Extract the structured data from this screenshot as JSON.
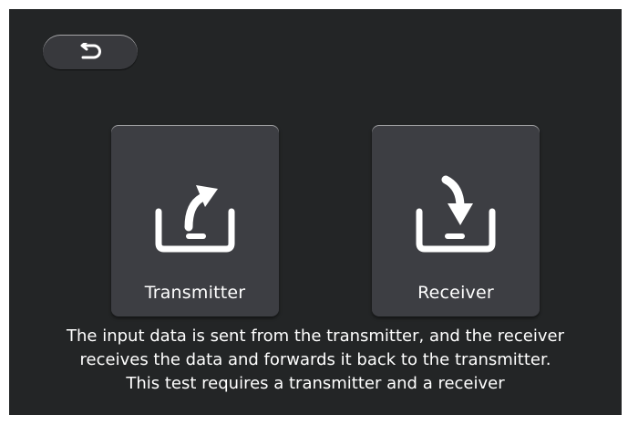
{
  "back_button": {
    "icon": "undo-arrow-icon"
  },
  "cards": [
    {
      "label": "Transmitter",
      "icon": "upload-tray-icon"
    },
    {
      "label": "Receiver",
      "icon": "download-tray-icon"
    }
  ],
  "description": {
    "line1": "The input data is sent from the transmitter, and the receiver",
    "line2": "receives the data and forwards it back to the transmitter.",
    "line3": "This test requires a transmitter and a receiver"
  },
  "colors": {
    "background": "#232526",
    "card": "#3d3e43",
    "text": "#ffffff"
  }
}
